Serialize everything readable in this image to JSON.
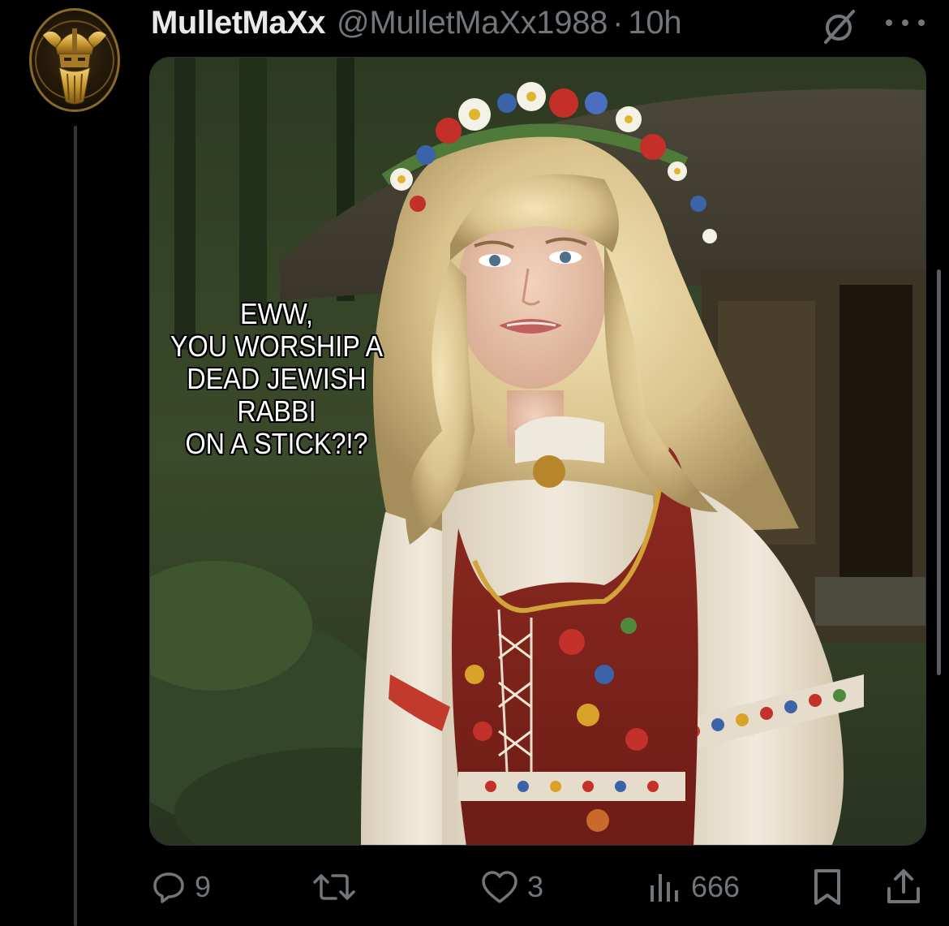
{
  "tweet": {
    "author": {
      "display_name": "MulletMaXx",
      "handle": "@MulletMaXx1988",
      "separator": "·",
      "time": "10h",
      "avatar_icon": "viking-helmet-avatar"
    },
    "header_icons": {
      "grok": "grok-icon",
      "more": "more-icon"
    },
    "media": {
      "caption_lines": [
        "EWW,",
        "YOU WORSHIP A",
        "DEAD JEWISH",
        "RABBI",
        "ON A STICK?!?"
      ]
    },
    "actions": {
      "replies": "9",
      "reposts": "",
      "likes": "3",
      "views": "666"
    }
  },
  "colors": {
    "background": "#000000",
    "text_primary": "#e7e9ea",
    "text_secondary": "#71767b",
    "divider": "#2f3336"
  }
}
